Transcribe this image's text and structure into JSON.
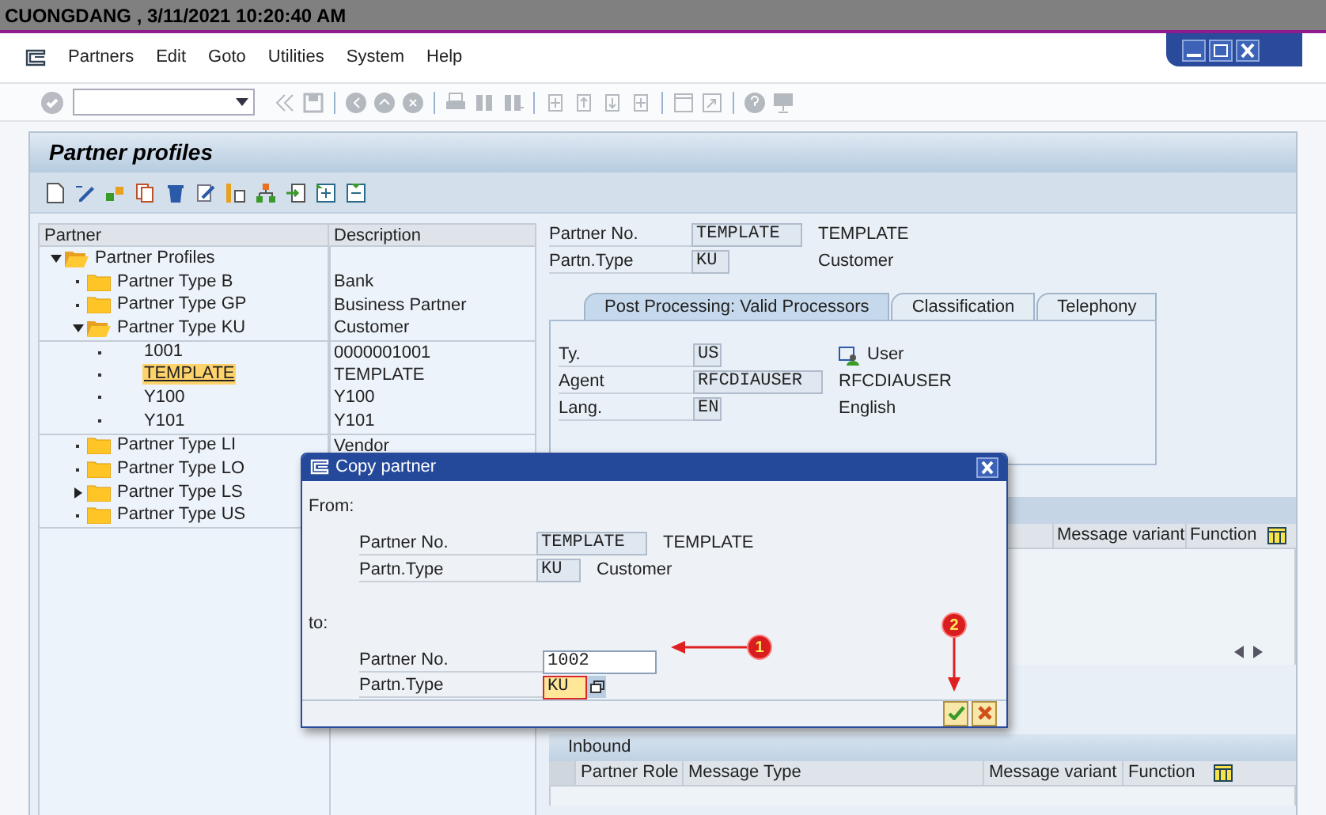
{
  "title_bar": {
    "text": "CUONGDANG  , 3/11/2021 10:20:40 AM"
  },
  "menu": [
    "Partners",
    "Edit",
    "Goto",
    "Utilities",
    "System",
    "Help"
  ],
  "panel": {
    "title": "Partner profiles"
  },
  "tree": {
    "columns": [
      "Partner",
      "Description"
    ],
    "nodes": [
      {
        "label": "Partner Profiles",
        "kind": "folder",
        "expanded": true,
        "selected": false,
        "children": [
          {
            "label": "Partner Type B",
            "description": "Bank",
            "kind": "folder",
            "selected": false
          },
          {
            "label": "Partner Type GP",
            "description": "Business Partner",
            "kind": "folder",
            "selected": false
          },
          {
            "label": "Partner Type KU",
            "description": "Customer",
            "kind": "folder",
            "expanded": true,
            "selected": false,
            "children": [
              {
                "label": "1001",
                "description": "0000001001",
                "kind": "item",
                "selected": false
              },
              {
                "label": "TEMPLATE",
                "description": "TEMPLATE",
                "kind": "item",
                "selected": true
              },
              {
                "label": "Y100",
                "description": "Y100",
                "kind": "item",
                "selected": false
              },
              {
                "label": "Y101",
                "description": "Y101",
                "kind": "item",
                "selected": false
              }
            ]
          },
          {
            "label": "Partner Type LI",
            "description": "Vendor",
            "kind": "folder",
            "selected": false
          },
          {
            "label": "Partner Type LO",
            "kind": "folder",
            "selected": false
          },
          {
            "label": "Partner Type LS",
            "kind": "folder",
            "expanded": false,
            "selected": false
          },
          {
            "label": "Partner Type US",
            "kind": "folder",
            "selected": false
          }
        ]
      }
    ]
  },
  "header_fields": [
    {
      "label": "Partner No.",
      "value": "TEMPLATE",
      "description": "TEMPLATE"
    },
    {
      "label": "Partn.Type",
      "value": "KU",
      "description": "Customer"
    }
  ],
  "tabs": [
    {
      "label": "Post Processing: Valid Processors",
      "selected": true
    },
    {
      "label": "Classification",
      "selected": false
    },
    {
      "label": "Telephony",
      "selected": false
    }
  ],
  "processor_fields": [
    {
      "label": "Ty.",
      "value": "US",
      "description": "User",
      "kind": "user"
    },
    {
      "label": "Agent",
      "value": "RFCDIAUSER",
      "description": "RFCDIAUSER",
      "kind": "plain"
    },
    {
      "label": "Lang.",
      "value": "EN",
      "description": "English",
      "kind": "plain"
    }
  ],
  "outbound_table": {
    "columns": [
      "Message variant",
      "Function"
    ]
  },
  "inbound_table": {
    "title": "Inbound",
    "columns": [
      "Partner Role",
      "Message Type",
      "Message variant",
      "Function"
    ]
  },
  "dialog": {
    "title": "Copy partner",
    "from": {
      "label": "From:",
      "fields": [
        {
          "label": "Partner No.",
          "value": "TEMPLATE",
          "description": "TEMPLATE",
          "editable": false,
          "focused": false
        },
        {
          "label": "Partn.Type",
          "value": "KU",
          "description": "Customer",
          "editable": false,
          "focused": false
        }
      ]
    },
    "to": {
      "label": "to:",
      "fields": [
        {
          "label": "Partner No.",
          "value": "1002",
          "editable": true,
          "focused": false
        },
        {
          "label": "Partn.Type",
          "value": "KU",
          "editable": true,
          "focused": true
        }
      ]
    }
  },
  "annotations": [
    {
      "label": "1"
    },
    {
      "label": "2"
    }
  ]
}
